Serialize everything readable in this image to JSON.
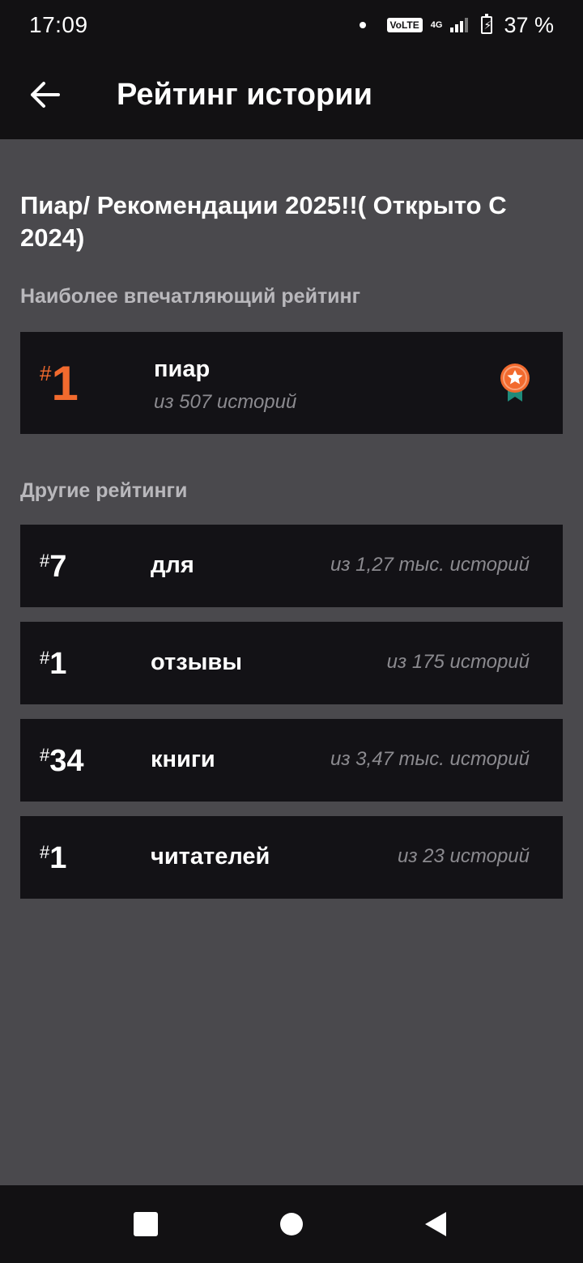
{
  "status_bar": {
    "time": "17:09",
    "volte": "VoLTE",
    "network": "4G",
    "battery": "37 %"
  },
  "app_bar": {
    "title": "Рейтинг истории",
    "back_icon": "arrow-left-icon"
  },
  "story": {
    "title": "Пиар/ Рекомендации 2025!!( Открыто С 2024)"
  },
  "best_section": {
    "heading": "Наиболее впечатляющий рейтинг",
    "card": {
      "hash": "#",
      "rank": "1",
      "tag": "пиар",
      "count": "из 507 историй",
      "icon": "medal-icon"
    }
  },
  "other_section": {
    "heading": "Другие рейтинги",
    "items": [
      {
        "hash": "#",
        "rank": "7",
        "tag": "для",
        "count": "из 1,27 тыс. историй"
      },
      {
        "hash": "#",
        "rank": "1",
        "tag": "отзывы",
        "count": "из 175 историй"
      },
      {
        "hash": "#",
        "rank": "34",
        "tag": "книги",
        "count": "из 3,47 тыс. историй"
      },
      {
        "hash": "#",
        "rank": "1",
        "tag": "читателей",
        "count": "из 23 историй"
      }
    ]
  },
  "colors": {
    "accent": "#f26a2e",
    "card_bg": "#131216",
    "page_bg": "#4a494d",
    "bar_bg": "#121113",
    "muted_text": "#8b8a8f",
    "heading_text": "#b9b8bc",
    "medal_ribbon": "#1f8a7a"
  },
  "nav_bar": {
    "recent_icon": "square-icon",
    "home_icon": "circle-icon",
    "back_icon": "triangle-back-icon"
  }
}
